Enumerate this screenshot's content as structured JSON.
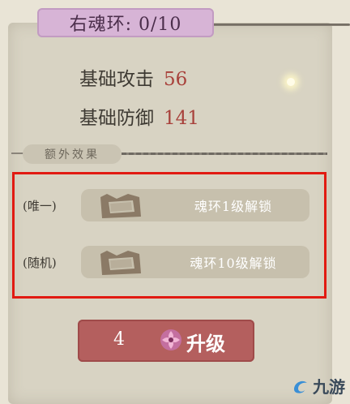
{
  "header": {
    "title": "右魂环: 0/10"
  },
  "stats": [
    {
      "label": "基础攻击",
      "value": "56"
    },
    {
      "label": "基础防御",
      "value": "141"
    }
  ],
  "extra_effects": {
    "section_label": "额外效果",
    "items": [
      {
        "tag": "(唯一)",
        "text": "魂环1级解锁"
      },
      {
        "tag": "(随机)",
        "text": "魂环10级解锁"
      }
    ]
  },
  "upgrade": {
    "cost": "4",
    "label": "升级",
    "icon": "soul-flower-icon"
  },
  "watermark": {
    "text": "九游",
    "logo": "jiuyou-logo"
  },
  "colors": {
    "title_tab": "#d7b4d6",
    "stat_value": "#a8413b",
    "highlight_border": "#e11a12",
    "upgrade_button": "#b45f5e"
  }
}
